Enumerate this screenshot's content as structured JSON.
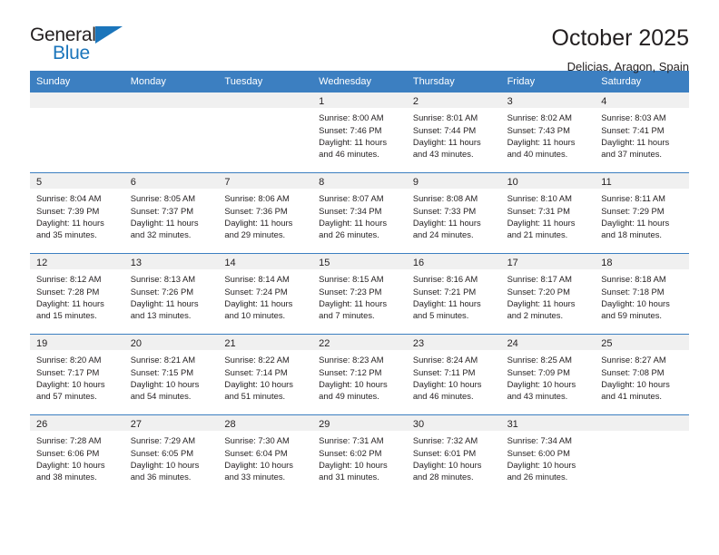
{
  "brand": {
    "name_part1": "General",
    "name_part2": "Blue",
    "triangle_icon": "triangle-icon",
    "accent_color": "#1b75bb"
  },
  "header": {
    "title": "October 2025",
    "subtitle": "Delicias, Aragon, Spain"
  },
  "colors": {
    "header_blue": "#3c7fc1",
    "daynum_band": "#f0f0f0",
    "text": "#231f20",
    "brand_blue": "#1b75bb"
  },
  "weekday_headers": [
    "Sunday",
    "Monday",
    "Tuesday",
    "Wednesday",
    "Thursday",
    "Friday",
    "Saturday"
  ],
  "weeks": [
    [
      {
        "day": "",
        "empty": true,
        "lines": []
      },
      {
        "day": "",
        "empty": true,
        "lines": []
      },
      {
        "day": "",
        "empty": true,
        "lines": []
      },
      {
        "day": "1",
        "empty": false,
        "lines": [
          "Sunrise: 8:00 AM",
          "Sunset: 7:46 PM",
          "Daylight: 11 hours",
          "and 46 minutes."
        ]
      },
      {
        "day": "2",
        "empty": false,
        "lines": [
          "Sunrise: 8:01 AM",
          "Sunset: 7:44 PM",
          "Daylight: 11 hours",
          "and 43 minutes."
        ]
      },
      {
        "day": "3",
        "empty": false,
        "lines": [
          "Sunrise: 8:02 AM",
          "Sunset: 7:43 PM",
          "Daylight: 11 hours",
          "and 40 minutes."
        ]
      },
      {
        "day": "4",
        "empty": false,
        "lines": [
          "Sunrise: 8:03 AM",
          "Sunset: 7:41 PM",
          "Daylight: 11 hours",
          "and 37 minutes."
        ]
      }
    ],
    [
      {
        "day": "5",
        "empty": false,
        "lines": [
          "Sunrise: 8:04 AM",
          "Sunset: 7:39 PM",
          "Daylight: 11 hours",
          "and 35 minutes."
        ]
      },
      {
        "day": "6",
        "empty": false,
        "lines": [
          "Sunrise: 8:05 AM",
          "Sunset: 7:37 PM",
          "Daylight: 11 hours",
          "and 32 minutes."
        ]
      },
      {
        "day": "7",
        "empty": false,
        "lines": [
          "Sunrise: 8:06 AM",
          "Sunset: 7:36 PM",
          "Daylight: 11 hours",
          "and 29 minutes."
        ]
      },
      {
        "day": "8",
        "empty": false,
        "lines": [
          "Sunrise: 8:07 AM",
          "Sunset: 7:34 PM",
          "Daylight: 11 hours",
          "and 26 minutes."
        ]
      },
      {
        "day": "9",
        "empty": false,
        "lines": [
          "Sunrise: 8:08 AM",
          "Sunset: 7:33 PM",
          "Daylight: 11 hours",
          "and 24 minutes."
        ]
      },
      {
        "day": "10",
        "empty": false,
        "lines": [
          "Sunrise: 8:10 AM",
          "Sunset: 7:31 PM",
          "Daylight: 11 hours",
          "and 21 minutes."
        ]
      },
      {
        "day": "11",
        "empty": false,
        "lines": [
          "Sunrise: 8:11 AM",
          "Sunset: 7:29 PM",
          "Daylight: 11 hours",
          "and 18 minutes."
        ]
      }
    ],
    [
      {
        "day": "12",
        "empty": false,
        "lines": [
          "Sunrise: 8:12 AM",
          "Sunset: 7:28 PM",
          "Daylight: 11 hours",
          "and 15 minutes."
        ]
      },
      {
        "day": "13",
        "empty": false,
        "lines": [
          "Sunrise: 8:13 AM",
          "Sunset: 7:26 PM",
          "Daylight: 11 hours",
          "and 13 minutes."
        ]
      },
      {
        "day": "14",
        "empty": false,
        "lines": [
          "Sunrise: 8:14 AM",
          "Sunset: 7:24 PM",
          "Daylight: 11 hours",
          "and 10 minutes."
        ]
      },
      {
        "day": "15",
        "empty": false,
        "lines": [
          "Sunrise: 8:15 AM",
          "Sunset: 7:23 PM",
          "Daylight: 11 hours",
          "and 7 minutes."
        ]
      },
      {
        "day": "16",
        "empty": false,
        "lines": [
          "Sunrise: 8:16 AM",
          "Sunset: 7:21 PM",
          "Daylight: 11 hours",
          "and 5 minutes."
        ]
      },
      {
        "day": "17",
        "empty": false,
        "lines": [
          "Sunrise: 8:17 AM",
          "Sunset: 7:20 PM",
          "Daylight: 11 hours",
          "and 2 minutes."
        ]
      },
      {
        "day": "18",
        "empty": false,
        "lines": [
          "Sunrise: 8:18 AM",
          "Sunset: 7:18 PM",
          "Daylight: 10 hours",
          "and 59 minutes."
        ]
      }
    ],
    [
      {
        "day": "19",
        "empty": false,
        "lines": [
          "Sunrise: 8:20 AM",
          "Sunset: 7:17 PM",
          "Daylight: 10 hours",
          "and 57 minutes."
        ]
      },
      {
        "day": "20",
        "empty": false,
        "lines": [
          "Sunrise: 8:21 AM",
          "Sunset: 7:15 PM",
          "Daylight: 10 hours",
          "and 54 minutes."
        ]
      },
      {
        "day": "21",
        "empty": false,
        "lines": [
          "Sunrise: 8:22 AM",
          "Sunset: 7:14 PM",
          "Daylight: 10 hours",
          "and 51 minutes."
        ]
      },
      {
        "day": "22",
        "empty": false,
        "lines": [
          "Sunrise: 8:23 AM",
          "Sunset: 7:12 PM",
          "Daylight: 10 hours",
          "and 49 minutes."
        ]
      },
      {
        "day": "23",
        "empty": false,
        "lines": [
          "Sunrise: 8:24 AM",
          "Sunset: 7:11 PM",
          "Daylight: 10 hours",
          "and 46 minutes."
        ]
      },
      {
        "day": "24",
        "empty": false,
        "lines": [
          "Sunrise: 8:25 AM",
          "Sunset: 7:09 PM",
          "Daylight: 10 hours",
          "and 43 minutes."
        ]
      },
      {
        "day": "25",
        "empty": false,
        "lines": [
          "Sunrise: 8:27 AM",
          "Sunset: 7:08 PM",
          "Daylight: 10 hours",
          "and 41 minutes."
        ]
      }
    ],
    [
      {
        "day": "26",
        "empty": false,
        "lines": [
          "Sunrise: 7:28 AM",
          "Sunset: 6:06 PM",
          "Daylight: 10 hours",
          "and 38 minutes."
        ]
      },
      {
        "day": "27",
        "empty": false,
        "lines": [
          "Sunrise: 7:29 AM",
          "Sunset: 6:05 PM",
          "Daylight: 10 hours",
          "and 36 minutes."
        ]
      },
      {
        "day": "28",
        "empty": false,
        "lines": [
          "Sunrise: 7:30 AM",
          "Sunset: 6:04 PM",
          "Daylight: 10 hours",
          "and 33 minutes."
        ]
      },
      {
        "day": "29",
        "empty": false,
        "lines": [
          "Sunrise: 7:31 AM",
          "Sunset: 6:02 PM",
          "Daylight: 10 hours",
          "and 31 minutes."
        ]
      },
      {
        "day": "30",
        "empty": false,
        "lines": [
          "Sunrise: 7:32 AM",
          "Sunset: 6:01 PM",
          "Daylight: 10 hours",
          "and 28 minutes."
        ]
      },
      {
        "day": "31",
        "empty": false,
        "lines": [
          "Sunrise: 7:34 AM",
          "Sunset: 6:00 PM",
          "Daylight: 10 hours",
          "and 26 minutes."
        ]
      },
      {
        "day": "",
        "empty": true,
        "lines": []
      }
    ]
  ]
}
